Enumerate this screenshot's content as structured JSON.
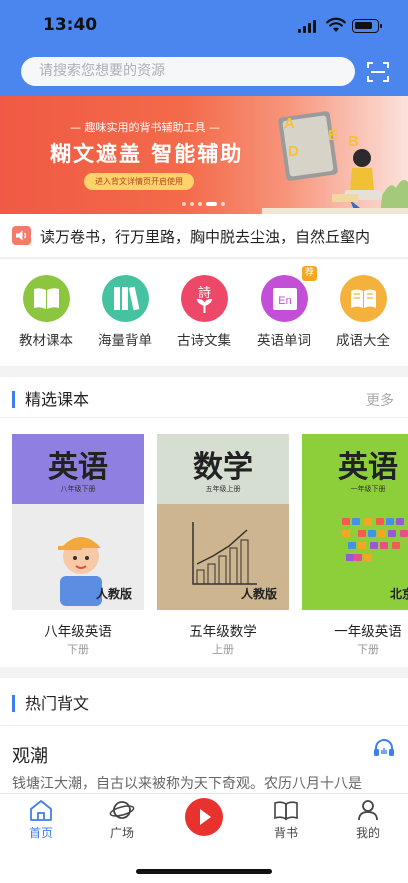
{
  "status": {
    "time": "13:40"
  },
  "search": {
    "placeholder": "请搜索您想要的资源"
  },
  "banner": {
    "subtitle": "— 趣味实用的背书辅助工具 —",
    "title": "糊文遮盖 智能辅助",
    "button": "进入背文详情页开启使用",
    "letters": [
      "A",
      "B",
      "D",
      "E"
    ]
  },
  "notice": {
    "text": "读万卷书，行万里路，胸中脱去尘浊，自然丘壑内"
  },
  "categories": [
    {
      "label": "教材课本",
      "icon": "book-icon",
      "color": "#8cc63f"
    },
    {
      "label": "海量背单",
      "icon": "books-icon",
      "color": "#45c3a0"
    },
    {
      "label": "古诗文集",
      "icon": "poem-icon",
      "color": "#ee4869",
      "glyph": "詩"
    },
    {
      "label": "英语单词",
      "icon": "english-icon",
      "color": "#c34fd6",
      "glyph": "En",
      "badge": "荐"
    },
    {
      "label": "成语大全",
      "icon": "idiom-book-icon",
      "color": "#f4b23c"
    }
  ],
  "featured": {
    "title": "精选课本",
    "more": "更多",
    "books": [
      {
        "cover_title": "英语",
        "grade": "八年级下册",
        "publisher": "人教版",
        "name": "八年级英语",
        "volume": "下册",
        "top_color": "#8f7fe0",
        "bottom_color": "#ececec"
      },
      {
        "cover_title": "数学",
        "grade": "五年级上册",
        "publisher": "人教版",
        "name": "五年级数学",
        "volume": "上册",
        "top_color": "#d6ded2",
        "bottom_color": "#cdb68f"
      },
      {
        "cover_title": "英语",
        "grade": "一年级下册",
        "publisher": "北京版",
        "name": "一年级英语",
        "volume": "下册",
        "top_color": "#8ccf3a",
        "bottom_color": "#8ccf3a"
      }
    ]
  },
  "hot": {
    "title": "热门背文",
    "poem_title": "观潮",
    "poem_text": "钱塘江大潮，自古以来被称为天下奇观。农历八月十八是"
  },
  "tabs": [
    {
      "label": "首页",
      "icon": "home-icon",
      "active": true
    },
    {
      "label": "广场",
      "icon": "planet-icon"
    },
    {
      "label": "背书",
      "icon": "open-book-icon"
    },
    {
      "label": "我的",
      "icon": "user-icon"
    }
  ]
}
